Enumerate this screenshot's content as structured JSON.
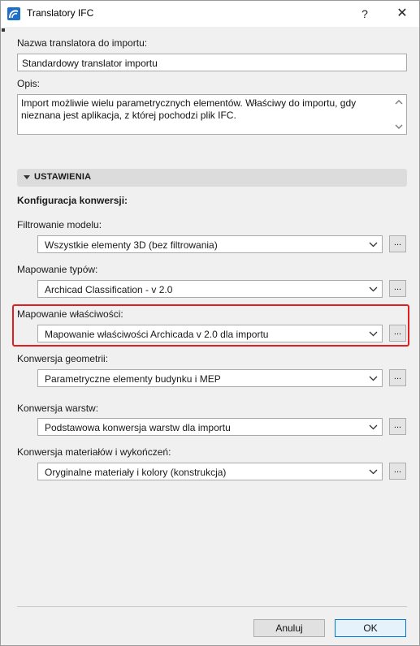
{
  "window": {
    "title": "Translatory IFC",
    "help_glyph": "?",
    "close_glyph": "✕",
    "app_icon": "archicad-icon"
  },
  "name_field": {
    "label": "Nazwa translatora do importu:",
    "value": "Standardowy translator importu"
  },
  "description": {
    "label": "Opis:",
    "value": "Import możliwie wielu parametrycznych elementów. Właściwy do importu, gdy nieznana jest aplikacja, z której pochodzi plik IFC."
  },
  "settings": {
    "header": "USTAWIENIA",
    "expanded": true,
    "subheading": "Konfiguracja konwersji:",
    "rows": [
      {
        "label": "Filtrowanie modelu:",
        "value": "Wszystkie elementy 3D (bez filtrowania)",
        "button": "..."
      },
      {
        "label": "Mapowanie typów:",
        "value": "Archicad Classification - v 2.0",
        "button": "..."
      },
      {
        "label": "Mapowanie właściwości:",
        "value": "Mapowanie właściwości Archicada v 2.0 dla importu",
        "button": "...",
        "highlighted": true
      },
      {
        "label": "Konwersja geometrii:",
        "value": "Parametryczne elementy budynku i MEP",
        "button": "..."
      },
      {
        "label": "Konwersja warstw:",
        "value": "Podstawowa konwersja warstw dla importu",
        "button": "..."
      },
      {
        "label": "Konwersja materiałów i wykończeń:",
        "value": "Oryginalne materiały i kolory (konstrukcja)",
        "button": "..."
      }
    ]
  },
  "footer": {
    "cancel_label": "Anuluj",
    "ok_label": "OK"
  },
  "colors": {
    "highlight": "#e02020",
    "ok_border": "#0078d7",
    "app_icon": "#1f6fc7"
  }
}
